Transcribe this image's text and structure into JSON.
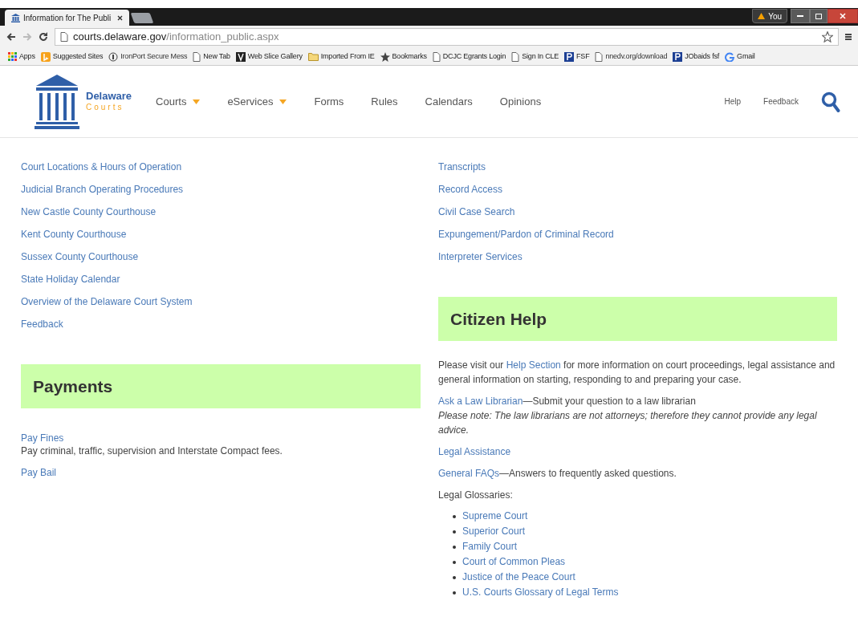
{
  "browser": {
    "tab_title": "Information for The Publi",
    "profile": "You",
    "url_host": "courts.delaware.gov",
    "url_path": "/information_public.aspx",
    "bookmarks": [
      {
        "kind": "apps",
        "label": "Apps"
      },
      {
        "kind": "bing",
        "label": "Suggested Sites"
      },
      {
        "kind": "ironport",
        "label": "IronPort Secure Mess"
      },
      {
        "kind": "page",
        "label": "New Tab"
      },
      {
        "kind": "webslice",
        "label": "Web Slice Gallery"
      },
      {
        "kind": "folder",
        "label": "Imported From IE"
      },
      {
        "kind": "star",
        "label": "Bookmarks"
      },
      {
        "kind": "page",
        "label": "DCJC Egrants Login"
      },
      {
        "kind": "page",
        "label": "Sign In CLE"
      },
      {
        "kind": "p",
        "label": "FSF"
      },
      {
        "kind": "page",
        "label": "nnedv.org/download"
      },
      {
        "kind": "p",
        "label": "JObaids fsf"
      },
      {
        "kind": "google",
        "label": "Gmail"
      }
    ]
  },
  "site": {
    "logo": {
      "name": "Delaware",
      "subtitle": "Courts"
    },
    "nav": [
      {
        "label": "Courts",
        "dropdown": true
      },
      {
        "label": "eServices",
        "dropdown": true
      },
      {
        "label": "Forms",
        "dropdown": false
      },
      {
        "label": "Rules",
        "dropdown": false
      },
      {
        "label": "Calendars",
        "dropdown": false
      },
      {
        "label": "Opinions",
        "dropdown": false
      }
    ],
    "utility": [
      "Help",
      "Feedback"
    ]
  },
  "left_links": [
    "Court Locations & Hours of Operation",
    "Judicial Branch Operating Procedures",
    "New Castle County Courthouse",
    "Kent County Courthouse",
    "Sussex County Courthouse",
    "State Holiday Calendar",
    "Overview of the Delaware Court System",
    "Feedback"
  ],
  "payments": {
    "title": "Payments",
    "items": [
      {
        "link": "Pay Fines",
        "description": "Pay criminal, traffic, supervision and Interstate Compact fees."
      },
      {
        "link": "Pay Bail"
      }
    ]
  },
  "right_links": [
    "Transcripts",
    "Record Access",
    "Civil Case Search",
    "Expungement/Pardon of Criminal Record",
    "Interpreter Services"
  ],
  "citizen_help": {
    "title": "Citizen Help",
    "blocks": [
      {
        "parts": [
          {
            "text": "Please visit our ",
            "link": false
          },
          {
            "text": "Help Section",
            "link": true
          },
          {
            "text": " for more information on court proceedings, legal assistance and general information on starting, responding to and preparing your case.",
            "link": false
          }
        ]
      },
      {
        "parts": [
          {
            "text": "Ask a Law Librarian",
            "link": true
          },
          {
            "text": "—Submit your question to a law librarian",
            "link": false
          }
        ],
        "note": "Please note: The law librarians are not attorneys; therefore they cannot provide any legal advice."
      },
      {
        "parts": [
          {
            "text": "Legal Assistance",
            "link": true
          }
        ]
      },
      {
        "parts": [
          {
            "text": "General FAQs",
            "link": true
          },
          {
            "text": "—Answers to frequently asked questions.",
            "link": false
          }
        ]
      },
      {
        "parts": [
          {
            "text": "Legal Glossaries:",
            "link": false
          }
        ]
      }
    ],
    "glossaries": [
      "Supreme Court",
      "Superior Court",
      "Family Court",
      "Court of Common Pleas",
      "Justice of the Peace Court",
      "U.S. Courts Glossary of Legal Terms"
    ]
  }
}
